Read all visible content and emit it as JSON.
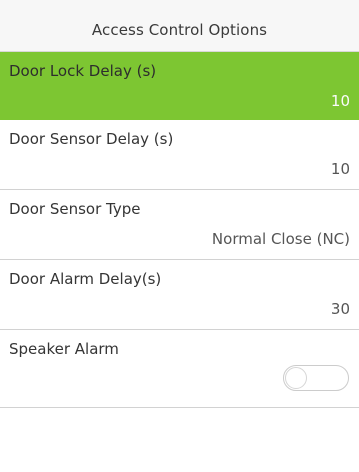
{
  "header": {
    "title": "Access Control Options"
  },
  "settings": [
    {
      "label": "Door Lock Delay (s)",
      "value": "10",
      "selected": true
    },
    {
      "label": "Door Sensor Delay (s)",
      "value": "10",
      "selected": false
    },
    {
      "label": "Door Sensor Type",
      "value": "Normal Close (NC)",
      "selected": false
    },
    {
      "label": "Door Alarm Delay(s)",
      "value": "30",
      "selected": false
    }
  ],
  "speaker_alarm": {
    "label": "Speaker Alarm",
    "enabled": false
  },
  "colors": {
    "selected_row": "#7dc632",
    "header_background": "#f7f7f7",
    "divider": "#d2d2d2"
  }
}
